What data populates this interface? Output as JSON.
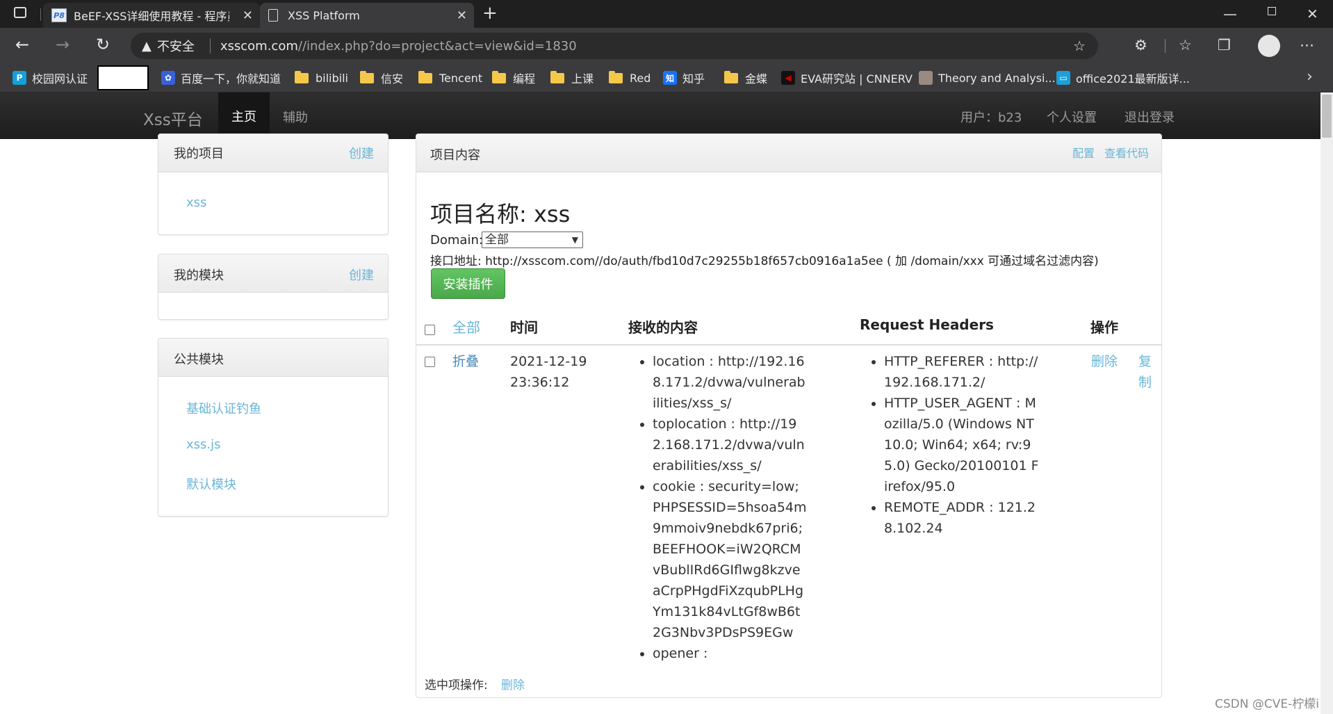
{
  "browser": {
    "tabs": [
      {
        "title": "BeEF-XSS详细使用教程 - 程序员",
        "favicon": "P8"
      },
      {
        "title": "XSS Platform"
      }
    ],
    "insecure_label": "不安全",
    "url_host": "xsscom.com",
    "url_rest": "//index.php?do=project&act=view&id=1830",
    "bookmarks": [
      "校园网认证",
      "百度一下，你就知道",
      "bilibili",
      "信安",
      "Tencent",
      "编程",
      "上课",
      "Red",
      "知乎",
      "金蝶",
      "EVA研究站 | CNNERV",
      "Theory and Analysi...",
      "office2021最新版详..."
    ]
  },
  "site": {
    "brand": "Xss平台",
    "nav": {
      "home": "主页",
      "aux": "辅助"
    },
    "user_label": "用户：b23",
    "settings": "个人设置",
    "logout": "退出登录"
  },
  "sidebar": {
    "projects": {
      "title": "我的项目",
      "action": "创建",
      "items": [
        "xss"
      ]
    },
    "modules": {
      "title": "我的模块",
      "action": "创建",
      "items": []
    },
    "public_modules": {
      "title": "公共模块",
      "items": [
        "基础认证钓鱼",
        "xss.js",
        "默认模块"
      ]
    }
  },
  "main": {
    "panel_title": "项目内容",
    "config_link": "配置",
    "view_code_link": "查看代码",
    "project_name": "项目名称: xss",
    "domain_label": "Domain:",
    "domain_value": "全部",
    "api_address": "接口地址: http://xsscom.com//do/auth/fbd10d7c29255b18f657cb0916a1a5ee ( 加 /domain/xxx 可通过域名过滤内容)",
    "install_button": "安装插件",
    "table": {
      "headers": [
        "全部",
        "时间",
        "接收的内容",
        "Request Headers",
        "操作"
      ],
      "row": {
        "toggle": "折叠",
        "time": "2021-12-19 23:36:12",
        "content": [
          "location : http://192.168.171.2/dvwa/vulnerabilities/xss_s/",
          "toplocation : http://192.168.171.2/dvwa/vulnerabilities/xss_s/",
          "cookie : security=low; PHPSESSID=5hsoa54m9mmoiv9nebdk67pri6; BEEFHOOK=iW2QRCMvBublIRd6GIflwg8kzveaCrpPHgdFiXzqubPLHgYm131k84vLtGf8wB6t2G3Nbv3PDsPS9EGw",
          "opener :"
        ],
        "headers": [
          "HTTP_REFERER : http://192.168.171.2/",
          "HTTP_USER_AGENT : Mozilla/5.0 (Windows NT 10.0; Win64; x64; rv:95.0) Gecko/20100101 Firefox/95.0",
          "REMOTE_ADDR : 121.28.102.24"
        ],
        "actions": {
          "delete": "删除",
          "copy": "复制"
        }
      }
    },
    "selected_ops_label": "选中项操作:",
    "selected_delete": "删除"
  },
  "watermark": "CSDN @CVE-柠檬i"
}
